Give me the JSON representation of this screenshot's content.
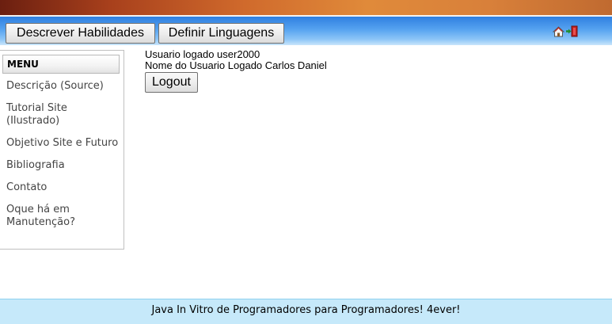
{
  "topnav": {
    "buttons": [
      {
        "label": "Descrever Habilidades"
      },
      {
        "label": "Definir Linguagens"
      }
    ],
    "icons": [
      "home-icon",
      "exit-icon"
    ]
  },
  "sidebar": {
    "menu_title": "MENU",
    "items": [
      {
        "label": "Descrição (Source)"
      },
      {
        "label": "Tutorial Site (Ilustrado)"
      },
      {
        "label": "Objetivo Site e Futuro"
      },
      {
        "label": "Bibliografia"
      },
      {
        "label": "Contato"
      },
      {
        "label": "Oque há em Manutenção?"
      }
    ]
  },
  "main": {
    "logged_user_line": "Usuario logado user2000",
    "logged_name_line": "Nome do Usuario Logado Carlos Daniel",
    "logout_label": "Logout"
  },
  "footer": {
    "text": "Java In Vitro de Programadores para Programadores! 4ever!"
  }
}
